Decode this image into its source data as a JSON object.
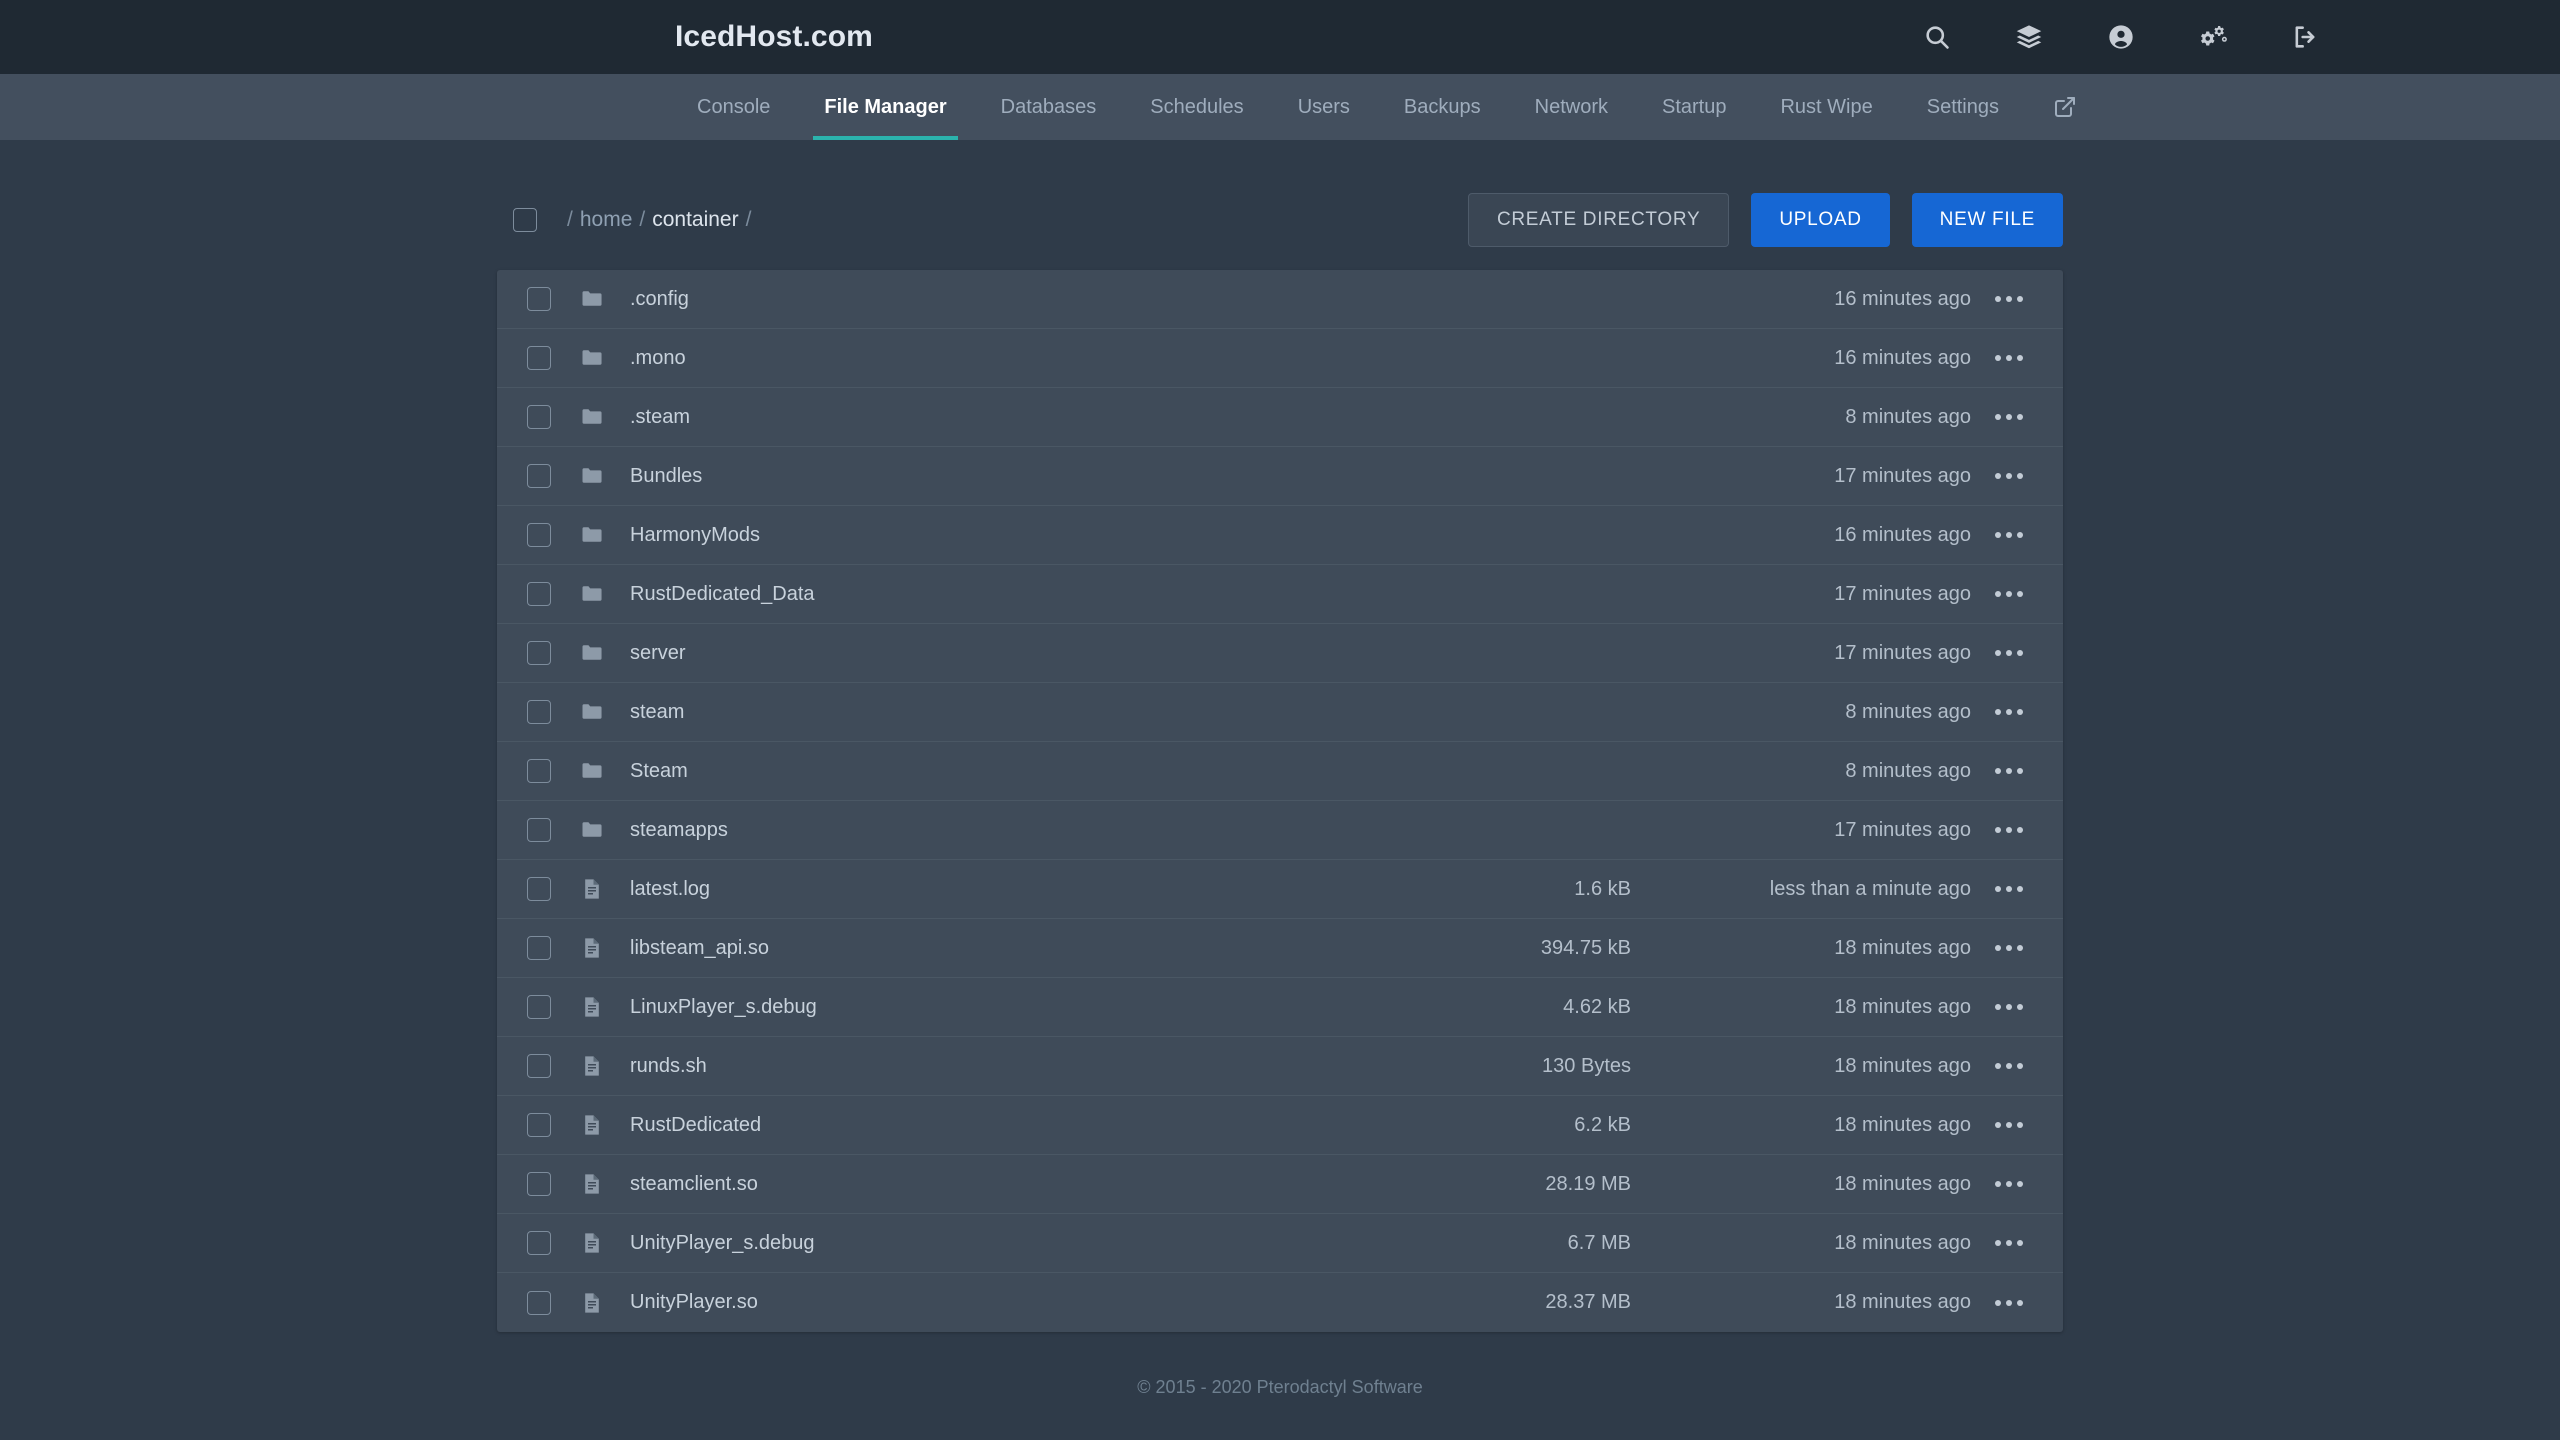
{
  "header": {
    "brand": "IcedHost.com",
    "icons": [
      {
        "name": "search-icon",
        "label": "Search"
      },
      {
        "name": "layers-icon",
        "label": "Servers"
      },
      {
        "name": "account-icon",
        "label": "Account"
      },
      {
        "name": "cogs-icon",
        "label": "Admin"
      },
      {
        "name": "logout-icon",
        "label": "Sign Out"
      }
    ]
  },
  "nav": {
    "tabs": [
      {
        "label": "Console",
        "active": false
      },
      {
        "label": "File Manager",
        "active": true
      },
      {
        "label": "Databases",
        "active": false
      },
      {
        "label": "Schedules",
        "active": false
      },
      {
        "label": "Users",
        "active": false
      },
      {
        "label": "Backups",
        "active": false
      },
      {
        "label": "Network",
        "active": false
      },
      {
        "label": "Startup",
        "active": false
      },
      {
        "label": "Rust Wipe",
        "active": false
      },
      {
        "label": "Settings",
        "active": false
      }
    ],
    "external_link_icon": "external-link-icon"
  },
  "toolbar": {
    "breadcrumb": {
      "root_sep": "/",
      "items": [
        {
          "label": "home",
          "current": false
        },
        {
          "label": "container",
          "current": true
        }
      ],
      "trailing_sep": "/"
    },
    "create_directory_label": "CREATE DIRECTORY",
    "upload_label": "UPLOAD",
    "new_file_label": "NEW FILE"
  },
  "colors": {
    "header_bg": "#1f2933",
    "nav_bg": "#434f5e",
    "page_bg": "#2f3b49",
    "row_bg": "#3f4b59",
    "accent_teal": "#2bb3ad",
    "accent_blue": "#1667d4"
  },
  "files": [
    {
      "name": ".config",
      "type": "folder",
      "size": "",
      "modified": "16 minutes ago"
    },
    {
      "name": ".mono",
      "type": "folder",
      "size": "",
      "modified": "16 minutes ago"
    },
    {
      "name": ".steam",
      "type": "folder",
      "size": "",
      "modified": "8 minutes ago"
    },
    {
      "name": "Bundles",
      "type": "folder",
      "size": "",
      "modified": "17 minutes ago"
    },
    {
      "name": "HarmonyMods",
      "type": "folder",
      "size": "",
      "modified": "16 minutes ago"
    },
    {
      "name": "RustDedicated_Data",
      "type": "folder",
      "size": "",
      "modified": "17 minutes ago"
    },
    {
      "name": "server",
      "type": "folder",
      "size": "",
      "modified": "17 minutes ago"
    },
    {
      "name": "steam",
      "type": "folder",
      "size": "",
      "modified": "8 minutes ago"
    },
    {
      "name": "Steam",
      "type": "folder",
      "size": "",
      "modified": "8 minutes ago"
    },
    {
      "name": "steamapps",
      "type": "folder",
      "size": "",
      "modified": "17 minutes ago"
    },
    {
      "name": "latest.log",
      "type": "file",
      "size": "1.6 kB",
      "modified": "less than a minute ago"
    },
    {
      "name": "libsteam_api.so",
      "type": "file",
      "size": "394.75 kB",
      "modified": "18 minutes ago"
    },
    {
      "name": "LinuxPlayer_s.debug",
      "type": "file",
      "size": "4.62 kB",
      "modified": "18 minutes ago"
    },
    {
      "name": "runds.sh",
      "type": "file",
      "size": "130 Bytes",
      "modified": "18 minutes ago"
    },
    {
      "name": "RustDedicated",
      "type": "file",
      "size": "6.2 kB",
      "modified": "18 minutes ago"
    },
    {
      "name": "steamclient.so",
      "type": "file",
      "size": "28.19 MB",
      "modified": "18 minutes ago"
    },
    {
      "name": "UnityPlayer_s.debug",
      "type": "file",
      "size": "6.7 MB",
      "modified": "18 minutes ago"
    },
    {
      "name": "UnityPlayer.so",
      "type": "file",
      "size": "28.37 MB",
      "modified": "18 minutes ago"
    }
  ],
  "footer": {
    "copyright": "© 2015 - 2020 Pterodactyl Software"
  }
}
